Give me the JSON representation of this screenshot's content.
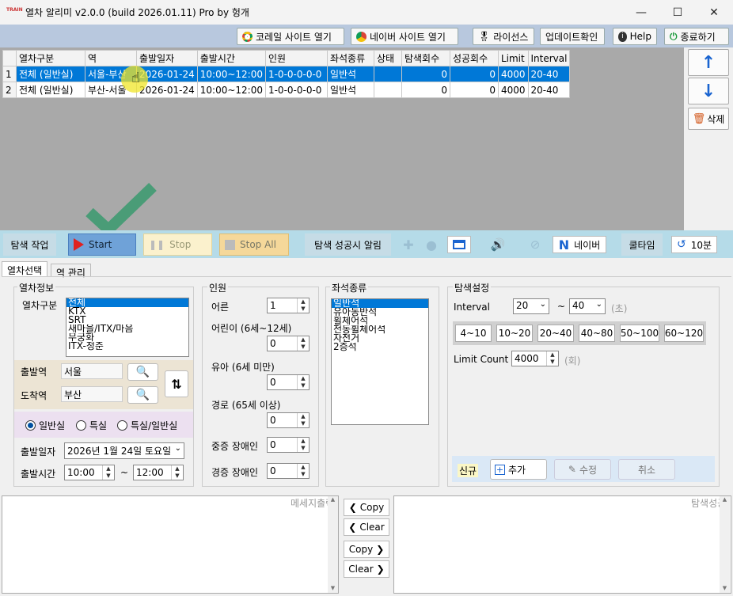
{
  "window": {
    "title": "열차 알리미 v2.0.0 (build 2026.01.11) Pro by 헝개",
    "minimize": "—",
    "maximize": "☐",
    "close": "✕"
  },
  "toolbar": {
    "korail": "코레일 사이트 열기",
    "naver": "네이버 사이트 열기",
    "license": "라이선스",
    "update": "업데이트확인",
    "help": "Help",
    "exit": "종료하기"
  },
  "grid": {
    "columns": [
      "",
      "열차구분",
      "역",
      "출발일자",
      "출발시간",
      "인원",
      "좌석종류",
      "상태",
      "탐색회수",
      "성공회수",
      "Limit",
      "Interval"
    ],
    "rows": [
      [
        "1",
        "전체 (일반실)",
        "서울-부산",
        "2026-01-24",
        "10:00~12:00",
        "1-0-0-0-0-0",
        "일반석",
        "",
        "0",
        "0",
        "4000",
        "20-40"
      ],
      [
        "2",
        "전체 (일반실)",
        "부산-서울",
        "2026-01-24",
        "10:00~12:00",
        "1-0-0-0-0-0",
        "일반석",
        "",
        "0",
        "0",
        "4000",
        "20-40"
      ]
    ]
  },
  "side": {
    "up": "↑",
    "down": "↓",
    "delete": "삭제"
  },
  "control": {
    "search_job": "탐색 작업",
    "start": "Start",
    "stop": "Stop",
    "stop_all": "Stop All",
    "alarm": "탐색 성공시 알림",
    "naver": "네이버",
    "cool": "쿨타임",
    "cool_value": "10분"
  },
  "tabs": [
    "열차선택",
    "역 관리"
  ],
  "train_info": {
    "title": "열차정보",
    "type_label": "열차구분",
    "types": [
      "전체",
      "KTX",
      "SRT",
      "새마을/ITX/마음",
      "무궁화",
      "ITX-청춘"
    ],
    "dep_label": "출발역",
    "dep_value": "서울",
    "arr_label": "도착역",
    "arr_value": "부산",
    "seat_options": [
      "일반실",
      "특실",
      "특실/일반실"
    ],
    "date_label": "출발일자",
    "date_value": "2026년  1월 24일 토요일",
    "time_label": "출발시간",
    "time_from": "10:00",
    "time_sep": "~",
    "time_to": "12:00"
  },
  "people": {
    "title": "인원",
    "items": [
      {
        "label": "어른",
        "value": "1"
      },
      {
        "label": "어린이 (6세~12세)",
        "value": "0"
      },
      {
        "label": "유아 (6세 미만)",
        "value": "0"
      },
      {
        "label": "경로 (65세 이상)",
        "value": "0"
      },
      {
        "label": "중증 장애인",
        "value": "0"
      },
      {
        "label": "경증 장애인",
        "value": "0"
      }
    ]
  },
  "seat": {
    "title": "좌석종류",
    "items": [
      "일반석",
      "유아동반석",
      "휠체어석",
      "전동휠체어석",
      "자전거",
      "2층석"
    ]
  },
  "search": {
    "title": "탐색설정",
    "interval_label": "Interval",
    "interval_from": "20",
    "interval_sep": "~",
    "interval_to": "40",
    "interval_unit": "(초)",
    "ranges": [
      "4~10",
      "10~20",
      "20~40",
      "40~80",
      "50~100",
      "60~120"
    ],
    "limit_label": "Limit Count",
    "limit_value": "4000",
    "limit_unit": "(회)",
    "new_label": "신규",
    "add": "추가",
    "edit": "수정",
    "cancel": "취소"
  },
  "bottom": {
    "msg_title": "메세지출력",
    "succ_title": "탐색성공",
    "copy": "Copy",
    "clear": "Clear"
  }
}
